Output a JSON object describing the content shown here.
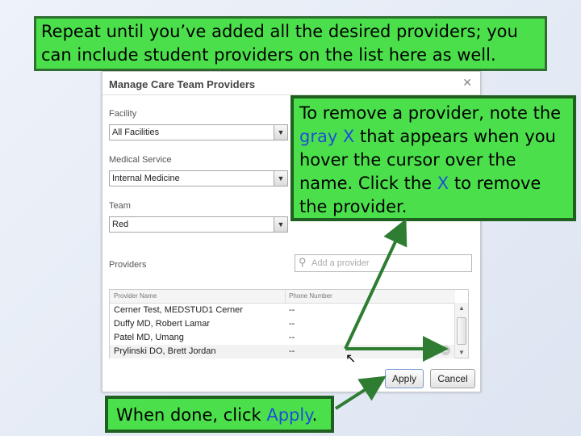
{
  "callouts": {
    "top": "Repeat until you’ve added all the desired providers; you can include student providers on the list here as well.",
    "right": {
      "p1": "To remove a provider, note the ",
      "gray_x": "gray X",
      "p2": " that appears when you hover the cursor over the name.  Click the ",
      "x": "X",
      "p3": " to remove the provider."
    },
    "bottom": {
      "p1": "When done, click ",
      "apply": "Apply",
      "p2": "."
    }
  },
  "dialog": {
    "title": "Manage Care Team Providers",
    "close_glyph": "✕",
    "facility_label": "Facility",
    "facility_value": "All Facilities",
    "medical_service_label": "Medical Service",
    "medical_service_value": "Internal Medicine",
    "team_label": "Team",
    "team_value": "Red",
    "providers_label": "Providers",
    "search_placeholder": "Add a provider",
    "table": {
      "columns": [
        "Provider Name",
        "Phone Number"
      ],
      "rows": [
        {
          "name": "Cerner Test, MEDSTUD1 Cerner",
          "phone": "--"
        },
        {
          "name": "Duffy MD, Robert Lamar",
          "phone": "--"
        },
        {
          "name": "Patel MD, Umang",
          "phone": "--"
        },
        {
          "name": "Prylinski DO, Brett Jordan",
          "phone": "--"
        }
      ]
    },
    "apply_label": "Apply",
    "cancel_label": "Cancel"
  },
  "colors": {
    "callout_fill": "#4be04b",
    "callout_border": "#2f6f2f",
    "arrow": "#2e7d32",
    "accent_text": "#1d4fd8"
  }
}
